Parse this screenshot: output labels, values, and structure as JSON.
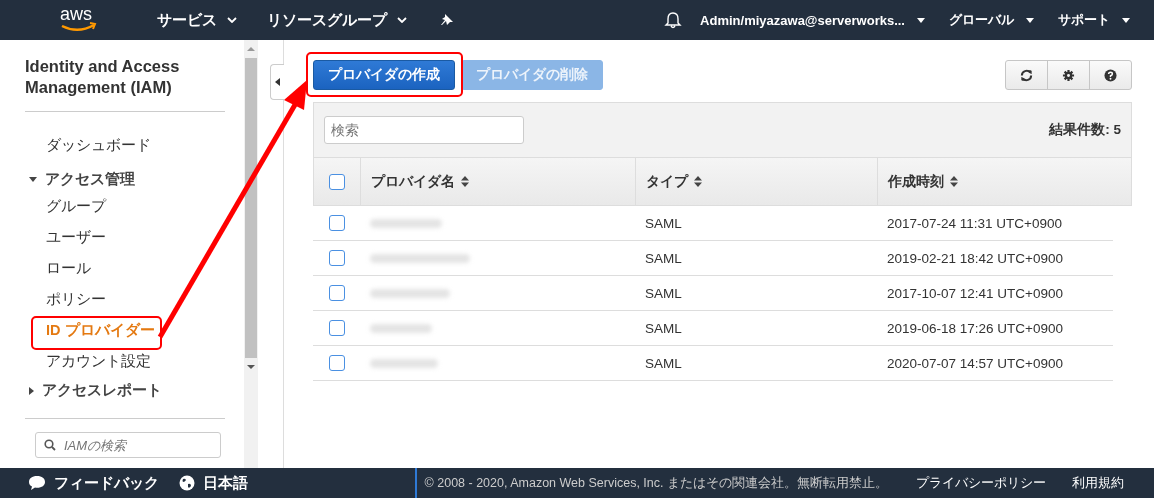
{
  "header": {
    "logo": "aws",
    "menus": [
      {
        "label": "サービス"
      },
      {
        "label": "リソースグループ"
      }
    ],
    "account": "Admin/miyazawa@serverworks...",
    "region": "グローバル",
    "support": "サポート"
  },
  "sidebar": {
    "title": "Identity and Access Management (IAM)",
    "items": [
      {
        "kind": "link",
        "label": "ダッシュボード",
        "selected": false
      },
      {
        "kind": "section",
        "label": "アクセス管理",
        "expanded": true,
        "children": [
          {
            "label": "グループ",
            "selected": false
          },
          {
            "label": "ユーザー",
            "selected": false
          },
          {
            "label": "ロール",
            "selected": false
          },
          {
            "label": "ポリシー",
            "selected": false
          },
          {
            "label": "ID プロバイダー",
            "selected": true
          },
          {
            "label": "アカウント設定",
            "selected": false
          }
        ]
      },
      {
        "kind": "section",
        "label": "アクセスレポート",
        "expanded": false
      }
    ],
    "search": {
      "placeholder": "IAMの検索"
    }
  },
  "toolbar": {
    "buttons": [
      {
        "label": "プロバイダの作成",
        "disabled": false
      },
      {
        "label": "プロバイダの削除",
        "disabled": true
      }
    ]
  },
  "table": {
    "search": {
      "placeholder": "検索"
    },
    "result_count": "結果件数: 5",
    "all_checked": false,
    "columns": [
      "プロバイダ名",
      "タイプ",
      "作成時刻"
    ],
    "rows": [
      {
        "checked": false,
        "type": "SAML",
        "created": "2017-07-24 11:31 UTC+0900"
      },
      {
        "checked": false,
        "type": "SAML",
        "created": "2019-02-21 18:42 UTC+0900"
      },
      {
        "checked": false,
        "type": "SAML",
        "created": "2017-10-07 12:41 UTC+0900"
      },
      {
        "checked": false,
        "type": "SAML",
        "created": "2019-06-18 17:26 UTC+0900"
      },
      {
        "checked": false,
        "type": "SAML",
        "created": "2020-07-07 14:57 UTC+0900"
      }
    ]
  },
  "footer": {
    "feedback": "フィードバック",
    "language": "日本語",
    "copyright": "© 2008 - 2020, Amazon Web Services, Inc. またはその関連会社。無断転用禁止。",
    "links": [
      "プライバシーポリシー",
      "利用規約"
    ]
  }
}
